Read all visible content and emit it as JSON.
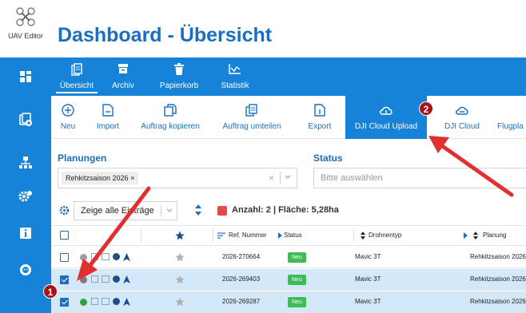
{
  "app": {
    "logo_text": "UAV Editor",
    "title": "Dashboard - Übersicht"
  },
  "sidebar": {
    "items": [
      {
        "icon": "dashboard-icon"
      },
      {
        "icon": "add-document-icon"
      },
      {
        "icon": "network-icon"
      },
      {
        "icon": "settings-icon"
      },
      {
        "icon": "info-icon"
      },
      {
        "icon": "support-icon"
      }
    ]
  },
  "tabs": [
    {
      "label": "Übersicht",
      "icon": "document-icon",
      "active": true
    },
    {
      "label": "Archiv",
      "icon": "archive-icon"
    },
    {
      "label": "Papierkorb",
      "icon": "trash-icon"
    },
    {
      "label": "Statistik",
      "icon": "chart-icon"
    }
  ],
  "toolbar": {
    "new": "Neu",
    "import": "Import",
    "copy": "Auftrag kopieren",
    "reassign": "Auftrag umteilen",
    "export": "Export",
    "dji_upload": "DJI Cloud Upload",
    "dji_cloud": "DJI Cloud",
    "flight": "Flugpla"
  },
  "filters": {
    "planungen_label": "Planungen",
    "planungen_chip": "Rehkitzsaison 2026",
    "status_label": "Status",
    "status_placeholder": "Bitte auswählen"
  },
  "controls": {
    "entries": "Zeige alle Einträge",
    "count": "Anzahl: 2 | Fläche: 5,28ha"
  },
  "table": {
    "headers": {
      "ref": "Ref. Nummer",
      "status": "Status",
      "drone": "Drohnentyp",
      "plan": "Planung"
    },
    "rows": [
      {
        "ref": "2026-270664",
        "status": "Neu",
        "drone": "Mavic 3T",
        "plan": "Rehkitzsaison 2026",
        "checked": false,
        "dot": "#9e9e9e"
      },
      {
        "ref": "2026-269403",
        "status": "Neu",
        "drone": "Mavic 3T",
        "plan": "Rehkitzsaison 2026",
        "checked": true,
        "dot": "#7a7a7a"
      },
      {
        "ref": "2026-269287",
        "status": "Neu",
        "drone": "Mavic 3T",
        "plan": "Rehkitzsaison 2026",
        "checked": true,
        "dot": "#2e9e3e"
      }
    ]
  },
  "annotations": {
    "one": "1",
    "two": "2"
  },
  "colors": {
    "primary": "#1683d8",
    "title": "#1a6fc0",
    "accent_red": "#e03030",
    "badge": "#3dbb56"
  }
}
